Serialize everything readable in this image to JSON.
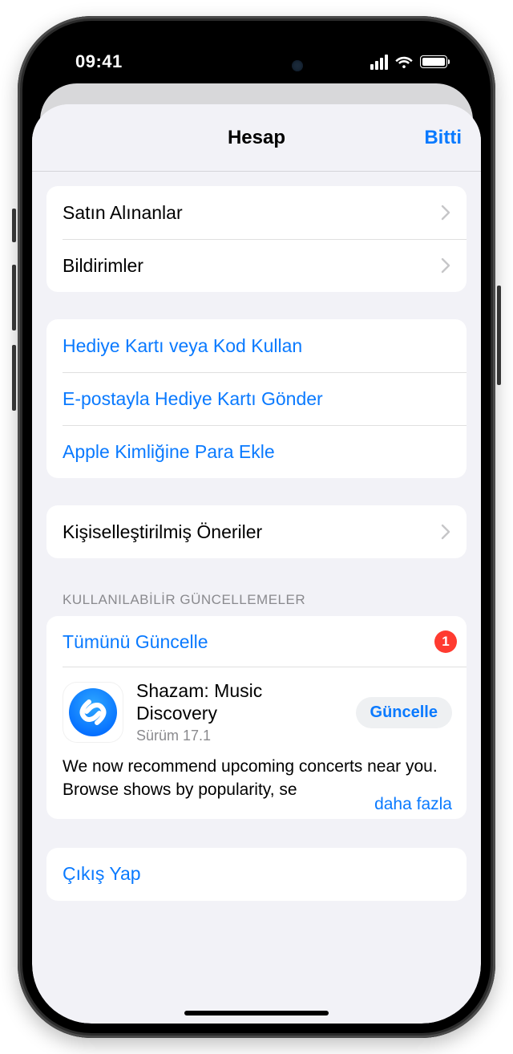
{
  "status": {
    "time": "09:41"
  },
  "nav": {
    "title": "Hesap",
    "done": "Bitti"
  },
  "group1": {
    "purchased": "Satın Alınanlar",
    "notifications": "Bildirimler"
  },
  "group2": {
    "redeem": "Hediye Kartı veya Kod Kullan",
    "sendGift": "E-postayla Hediye Kartı Gönder",
    "addFunds": "Apple Kimliğine Para Ekle"
  },
  "group3": {
    "personalized": "Kişiselleştirilmiş Öneriler"
  },
  "updates": {
    "header": "KULLANILABİLİR GÜNCELLEMELER",
    "updateAll": "Tümünü Güncelle",
    "badge": "1",
    "app": {
      "name": "Shazam: Music Discovery",
      "version": "Sürüm 17.1",
      "button": "Güncelle",
      "desc": "We now recommend upcoming concerts near you. Browse shows by popularity, se",
      "more": "daha fazla"
    }
  },
  "signout": "Çıkış Yap"
}
